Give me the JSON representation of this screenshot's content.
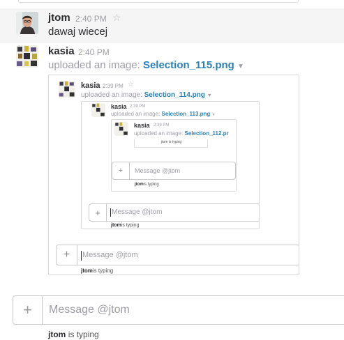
{
  "messages": [
    {
      "sender": "jtom",
      "time": "2:40 PM",
      "text": "dawaj wiecej"
    },
    {
      "sender": "kasia",
      "time": "2:40 PM",
      "upload_prefix": "uploaded an image:",
      "file": "Selection_115.png"
    }
  ],
  "nested": [
    {
      "sender": "kasia",
      "time": "2:39 PM",
      "upload_prefix": "uploaded an image:",
      "file": "Selection_114.png",
      "composer_placeholder": "Message @jtom",
      "typing_user": "jtom",
      "typing_suffix": "is typing"
    },
    {
      "sender": "kasia",
      "time": "2:39 PM",
      "upload_prefix": "uploaded an image:",
      "file": "Selection_113.png",
      "composer_placeholder": "Message @jtom",
      "typing_user": "jtom",
      "typing_suffix": "is typing"
    },
    {
      "sender": "kasia",
      "time": "2:39 PM",
      "upload_prefix": "uploaded an image:",
      "file": "Selection_112.pr",
      "composer_placeholder": "Message @jtom",
      "typing_user": "jtom",
      "typing_suffix": "is typing",
      "inner_typing": "jtom is typing"
    }
  ],
  "composer": {
    "plus": "+",
    "placeholder": "Message @jtom"
  },
  "typing": {
    "user": "jtom",
    "suffix": "is typing"
  },
  "icons": {
    "star": "star-outline-icon",
    "caret": "caret-down-icon",
    "plus": "plus-icon"
  },
  "colors": {
    "link": "#2a80b9",
    "muted": "#9e9ea6",
    "highlight": "#f5f5f5"
  }
}
